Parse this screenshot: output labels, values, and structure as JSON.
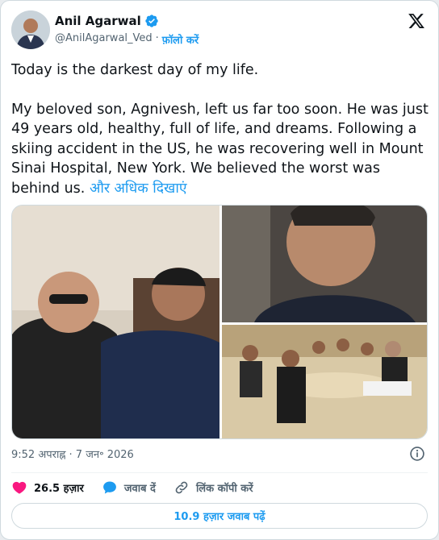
{
  "author": {
    "name": "Anil Agarwal",
    "handle": "@AnilAgarwal_Ved",
    "separator": "·",
    "follow_label": "फ़ॉलो करें"
  },
  "tweet": {
    "line1": "Today is the darkest day of my life.",
    "body": "My beloved son, Agnivesh, left us far too soon. He was just 49 years old, healthy, full of life, and dreams. Following a skiing accident in the US, he was recovering well in Mount Sinai Hospital, New York. We believed the worst was behind us. ",
    "show_more": "और अधिक दिखाएं"
  },
  "meta": {
    "timestamp": "9:52 अपराह्न · 7 जन॰ 2026"
  },
  "actions": {
    "likes": "26.5 हज़ार",
    "reply": "जवाब दें",
    "copy_link": "लिंक कॉपी करें"
  },
  "replies_button": "10.9 हज़ार जवाब पढ़ें",
  "icons": {
    "verified": "verified-badge-icon",
    "x_logo": "x-logo-icon",
    "info": "info-icon",
    "heart": "heart-icon",
    "reply": "reply-bubble-icon",
    "link": "link-icon"
  },
  "colors": {
    "accent": "#1d9bf0",
    "like": "#f91880",
    "text": "#0f1419",
    "secondary": "#536471",
    "border": "#cfd9de"
  }
}
